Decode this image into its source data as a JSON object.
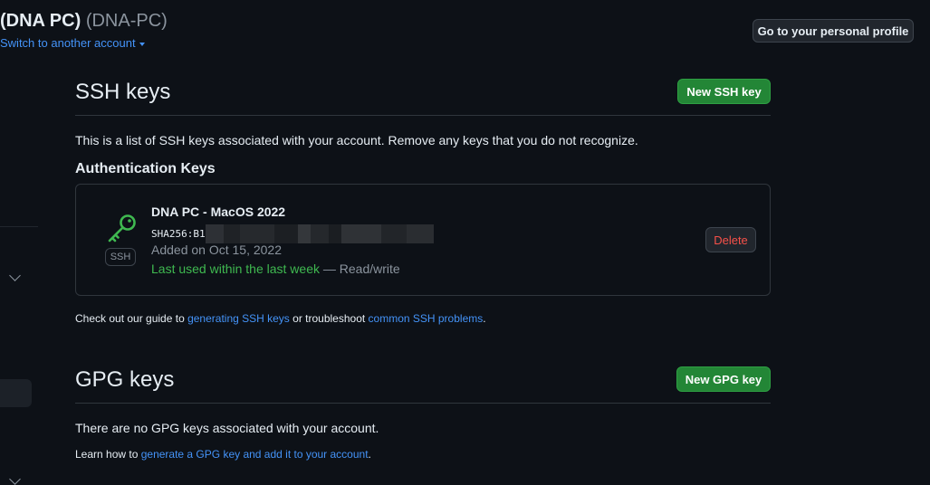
{
  "header": {
    "name": "(DNA PC)",
    "handle": "(DNA-PC)",
    "switch_account": "Switch to another account",
    "profile_button": "Go to your personal profile"
  },
  "ssh": {
    "title": "SSH keys",
    "new_button": "New SSH key",
    "description": "This is a list of SSH keys associated with your account. Remove any keys that you do not recognize.",
    "auth_heading": "Authentication Keys",
    "key": {
      "badge": "SSH",
      "title": "DNA PC - MacOS 2022",
      "fingerprint_prefix": "SHA256:B1",
      "added": "Added on Oct 15, 2022",
      "last_used": "Last used within the last week",
      "access": "— Read/write",
      "delete_button": "Delete"
    },
    "guide": {
      "prefix": "Check out our guide to ",
      "link1": "generating SSH keys",
      "middle": " or troubleshoot ",
      "link2": "common SSH problems",
      "suffix": "."
    }
  },
  "gpg": {
    "title": "GPG keys",
    "new_button": "New GPG key",
    "empty": "There are no GPG keys associated with your account.",
    "learn": {
      "prefix": "Learn how to ",
      "link": "generate a GPG key and add it to your account",
      "suffix": "."
    }
  },
  "colors": {
    "background": "#0d1117",
    "accent_link": "#4493f8",
    "success": "#238636",
    "danger": "#f85149",
    "key_icon": "#3fb950"
  },
  "icons": {
    "key": "key-icon",
    "caret": "triangle-down-icon",
    "chevron": "chevron-down-icon"
  }
}
